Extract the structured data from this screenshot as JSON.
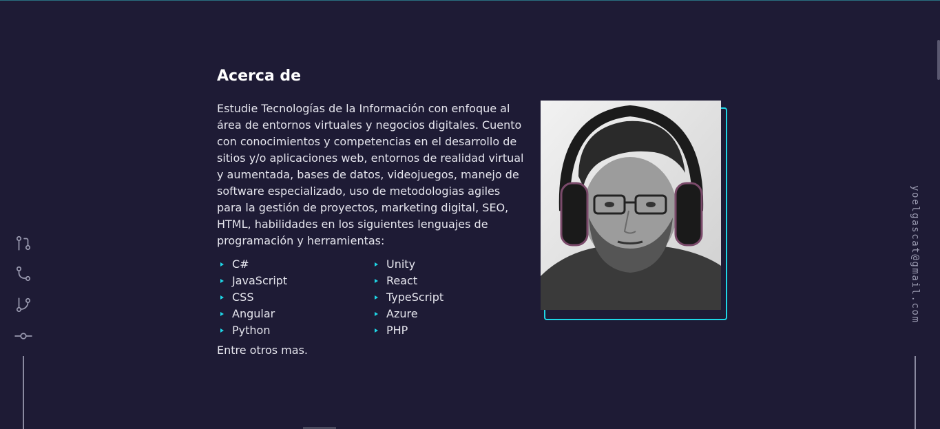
{
  "about": {
    "title": "Acerca de",
    "paragraph": "Estudie Tecnologías de la Información con enfoque al área de entornos virtuales y negocios digitales. Cuento con conocimientos y competencias en el desarrollo de sitios y/o aplicaciones web, entornos de realidad virtual y aumentada, bases de datos, videojuegos, manejo de software especializado, uso de metodologias agiles para la gestión de proyectos, marketing digital, SEO, HTML, habilidades en los siguientes lenguajes de programación y herramientas:",
    "skills": [
      "C#",
      "Unity",
      "JavaScript",
      "React",
      "CSS",
      "TypeScript",
      "Angular",
      "Azure",
      "Python",
      "PHP"
    ],
    "extra": "Entre otros mas."
  },
  "sidebar_right": {
    "email": "yoelgascat@gmail.com"
  },
  "sidebar_left": {
    "icons": [
      "git-pull-request-icon",
      "git-merge-icon",
      "git-branch-icon",
      "git-commit-icon"
    ]
  },
  "colors": {
    "background": "#1e1b35",
    "accent": "#1ed6e6",
    "text": "#e6e6ee"
  }
}
